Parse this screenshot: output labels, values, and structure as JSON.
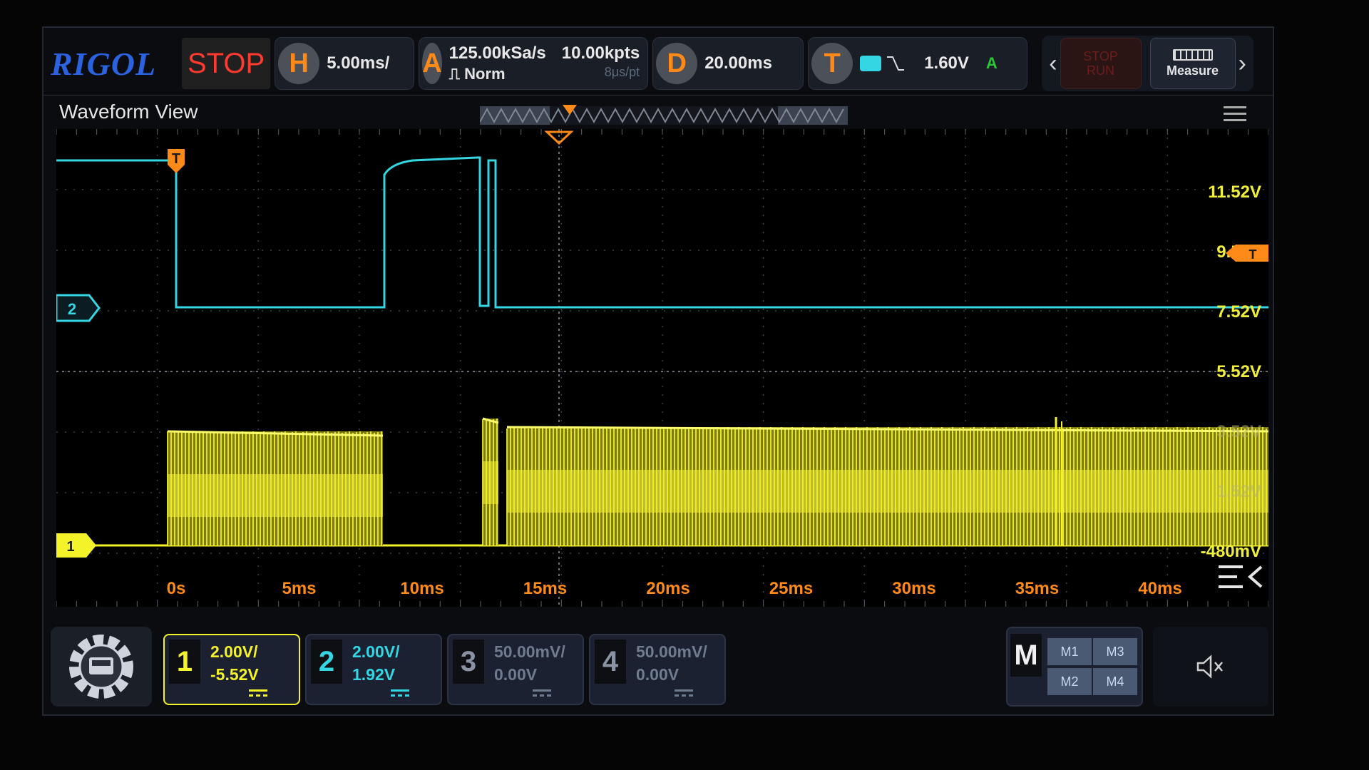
{
  "brand": "RIGOL",
  "run_state": "STOP",
  "horizontal": {
    "badge": "H",
    "scale": "5.00ms/"
  },
  "acquire": {
    "badge": "A",
    "sample_rate": "125.00kSa/s",
    "memory_depth": "10.00kpts",
    "mode": "Norm",
    "time_per_point": "8μs/pt"
  },
  "delay": {
    "badge": "D",
    "value": "20.00ms"
  },
  "trigger": {
    "badge": "T",
    "source": "2",
    "slope": "falling",
    "level": "1.60V",
    "status": "A"
  },
  "run_stop_button": {
    "line1": "STOP",
    "line2": "RUN"
  },
  "measure_button": {
    "label": "Measure"
  },
  "waveform_view": {
    "title": "Waveform View",
    "voltage_labels": [
      "11.52V",
      "9.52V",
      "7.52V",
      "5.52V",
      "3.52V",
      "1.52V",
      "-480mV"
    ],
    "time_labels": [
      "0s",
      "5ms",
      "10ms",
      "15ms",
      "20ms",
      "25ms",
      "30ms",
      "35ms",
      "40ms"
    ],
    "ch1_marker": "1",
    "ch2_marker": "2",
    "trigger_marker": "T"
  },
  "channels": [
    {
      "number": "1",
      "scale": "2.00V/",
      "offset": "-5.52V",
      "color": "#f4f32a",
      "active": true
    },
    {
      "number": "2",
      "scale": "2.00V/",
      "offset": "1.92V",
      "color": "#33d6e2",
      "active": false
    },
    {
      "number": "3",
      "scale": "50.00mV/",
      "offset": "0.00V",
      "color": "#6f7b8e",
      "active": false
    },
    {
      "number": "4",
      "scale": "50.00mV/",
      "offset": "0.00V",
      "color": "#6f7b8e",
      "active": false
    }
  ],
  "math": {
    "label": "M",
    "items": [
      "M1",
      "M3",
      "M2",
      "M4"
    ]
  },
  "icons": {
    "gear": "rigol-settings-gear-icon",
    "speaker": "speaker-muted-icon",
    "menu": "hamburger-menu-icon",
    "collapse": "collapse-panel-icon"
  },
  "colors": {
    "ch1": "#f4f32a",
    "ch2": "#33d6e2",
    "accent": "#ff8a18",
    "stop": "#ff3a2e",
    "brand": "#2a62e0"
  }
}
